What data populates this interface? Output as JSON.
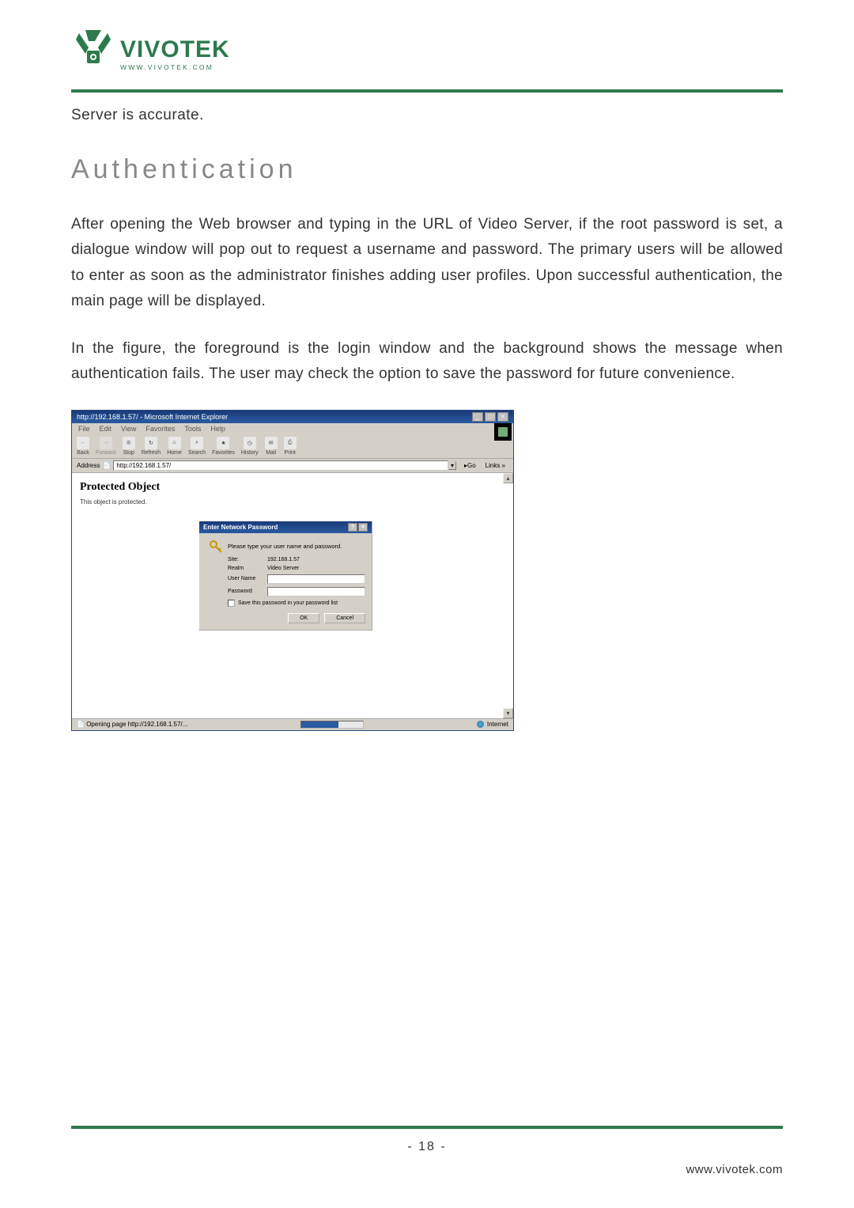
{
  "logo": {
    "brand": "VIVOTEK",
    "url": "www.vivotek.com"
  },
  "topFragment": "Server is accurate.",
  "heading": "Authentication",
  "para1": "After opening the Web browser and typing in the URL of Video Server, if the root password is set, a dialogue window will pop out to request a username and password. The primary users will be allowed to enter as soon as the administrator finishes adding user profiles. Upon successful authentication, the main page will be displayed.",
  "para2": "In the figure, the foreground is the login window and the background shows the message when authentication fails. The user may check the option to save the password for future convenience.",
  "ie": {
    "title": "http://192.168.1.57/ - Microsoft Internet Explorer",
    "menu": [
      "File",
      "Edit",
      "View",
      "Favorites",
      "Tools",
      "Help"
    ],
    "toolbar": [
      {
        "label": "Back",
        "glyph": "←"
      },
      {
        "label": "Forward",
        "glyph": "→"
      },
      {
        "label": "Stop",
        "glyph": "✕"
      },
      {
        "label": "Refresh",
        "glyph": "↻"
      },
      {
        "label": "Home",
        "glyph": "⌂"
      },
      {
        "label": "Search",
        "glyph": "🔍"
      },
      {
        "label": "Favorites",
        "glyph": "★"
      },
      {
        "label": "History",
        "glyph": "◷"
      },
      {
        "label": "Mail",
        "glyph": "✉"
      },
      {
        "label": "Print",
        "glyph": "⎙"
      }
    ],
    "addressLabel": "Address",
    "addressValue": "http://192.168.1.57/",
    "go": "Go",
    "links": "Links »",
    "protectedHeading": "Protected Object",
    "protectedText": "This object is protected.",
    "status": "Opening page http://192.168.1.57/...",
    "zone": "Internet"
  },
  "dialog": {
    "title": "Enter Network Password",
    "prompt": "Please type your user name and password.",
    "siteLabel": "Site:",
    "siteValue": "192.168.1.57",
    "realmLabel": "Realm",
    "realmValue": "Video Server",
    "userLabel": "User Name",
    "passLabel": "Password",
    "saveLabel": "Save this password in your password list",
    "ok": "OK",
    "cancel": "Cancel"
  },
  "pageNumber": "- 18 -",
  "footerUrl": "www.vivotek.com"
}
